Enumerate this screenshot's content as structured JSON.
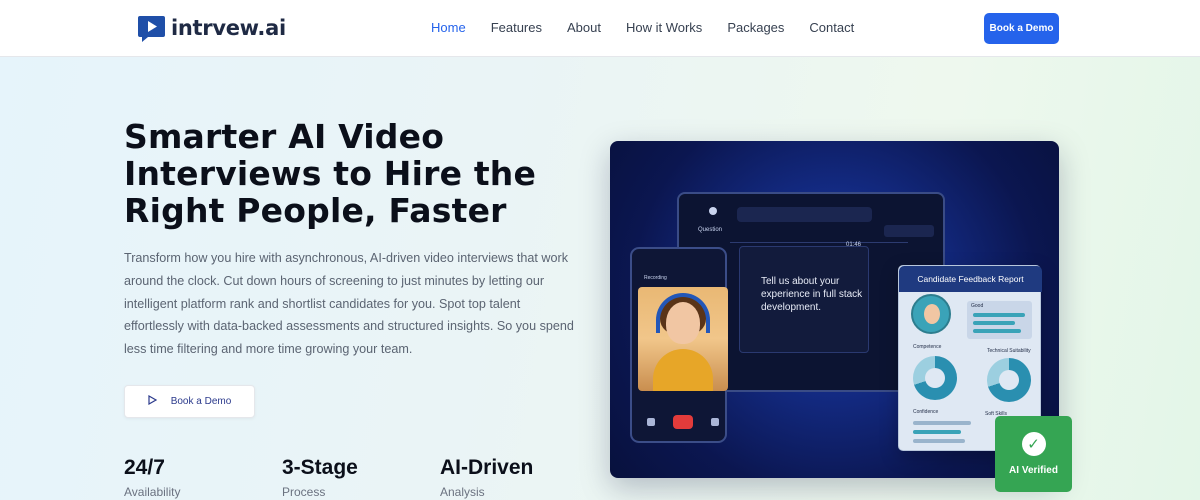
{
  "brand": {
    "name": "intrvew.ai",
    "logo_icon": "play-chat-icon",
    "accent": "#2563eb"
  },
  "nav": {
    "links": [
      "Home",
      "Features",
      "About",
      "How it Works",
      "Packages",
      "Contact"
    ],
    "active": "Home",
    "cta_label": "Book a Demo"
  },
  "hero": {
    "title": "Smarter AI Video Interviews to Hire the Right People, Faster",
    "description": "Transform how you hire with asynchronous, AI-driven video interviews that work around the clock. Cut down hours of screening to just minutes by letting our intelligent platform rank and shortlist candidates for you. Spot top talent effortlessly with data-backed assessments and structured insights. So you spend less time filtering and more time growing your team.",
    "cta_label": "Book a Demo",
    "cta_icon": "play-icon"
  },
  "stats": [
    {
      "value": "24/7",
      "label": "Availability"
    },
    {
      "value": "3-Stage",
      "label": "Process"
    },
    {
      "value": "AI-Driven",
      "label": "Analysis"
    }
  ],
  "illustration": {
    "question_label": "Question",
    "timer": "01:46",
    "question_text": "Tell us about your experience in full stack development.",
    "recording_label": "Recording",
    "report_title": "Candidate Feedback Report",
    "report_tag": "Good",
    "report_sections": [
      "Competence",
      "Technical Suitability",
      "Confidence",
      "Soft Skills"
    ],
    "verified_label": "AI Verified",
    "verified_icon": "check-icon"
  }
}
